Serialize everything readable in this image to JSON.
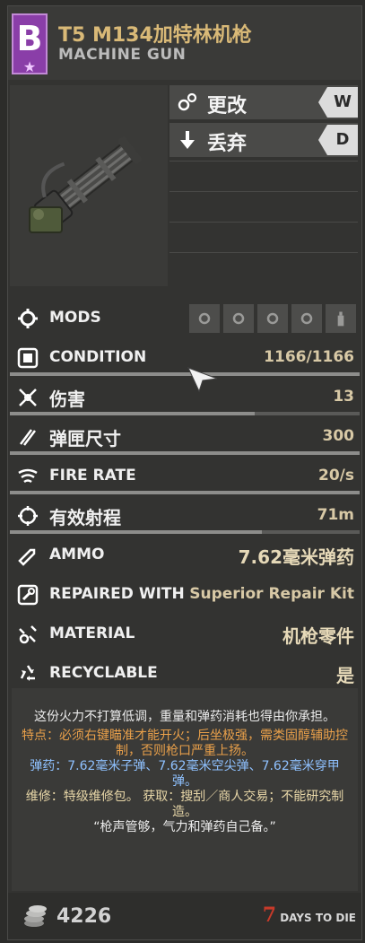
{
  "header": {
    "tier_letter": "B",
    "title": "T5 M134加特林机枪",
    "subtitle": "MACHINE GUN",
    "tier_color": "#8a3ea8"
  },
  "actions": [
    {
      "label": "更改",
      "key": "W",
      "icon": "gears-icon"
    },
    {
      "label": "丢弃",
      "key": "D",
      "icon": "arrow-down-icon"
    }
  ],
  "stats": [
    {
      "label": "MODS",
      "value": "",
      "icon": "gear-icon"
    },
    {
      "label": "CONDITION",
      "value": "1166/1166",
      "icon": "condition-icon",
      "fill": 1.0
    },
    {
      "label": "伤害",
      "value": "13",
      "icon": "damage-icon",
      "fill": 0.7
    },
    {
      "label": "弹匣尺寸",
      "value": "300",
      "icon": "magazine-icon",
      "fill": 1.0
    },
    {
      "label": "FIRE RATE",
      "value": "20/s",
      "icon": "fire-rate-icon",
      "fill": 1.0
    },
    {
      "label": "有效射程",
      "value": "71m",
      "icon": "range-icon",
      "fill": 0.72
    },
    {
      "label": "AMMO",
      "value": "7.62毫米弹药",
      "icon": "ammo-icon"
    },
    {
      "label": "REPAIRED WITH",
      "value": "Superior Repair Kit",
      "icon": "repair-icon"
    },
    {
      "label": "MATERIAL",
      "value": "机枪零件",
      "icon": "material-icon"
    },
    {
      "label": "RECYCLABLE",
      "value": "是",
      "icon": "recycle-icon"
    }
  ],
  "description": {
    "flavor": "这份火力不打算低调，重量和弹药消耗也得由你承担。",
    "feature": "特点：必须右键瞄准才能开火；后坐极强，需类固醇辅助控制，否则枪口严重上扬。",
    "ammo": "弹药：7.62毫米子弹、7.62毫米空尖弹、7.62毫米穿甲弹。",
    "repair": "维修：特级维修包。 获取：搜刮／商人交易；不能研究制造。",
    "quote": "“枪声管够，气力和弹药自己备。”"
  },
  "footer": {
    "coins": "4226",
    "logo_7": "7",
    "logo_text": "DAYS TO DIE"
  }
}
